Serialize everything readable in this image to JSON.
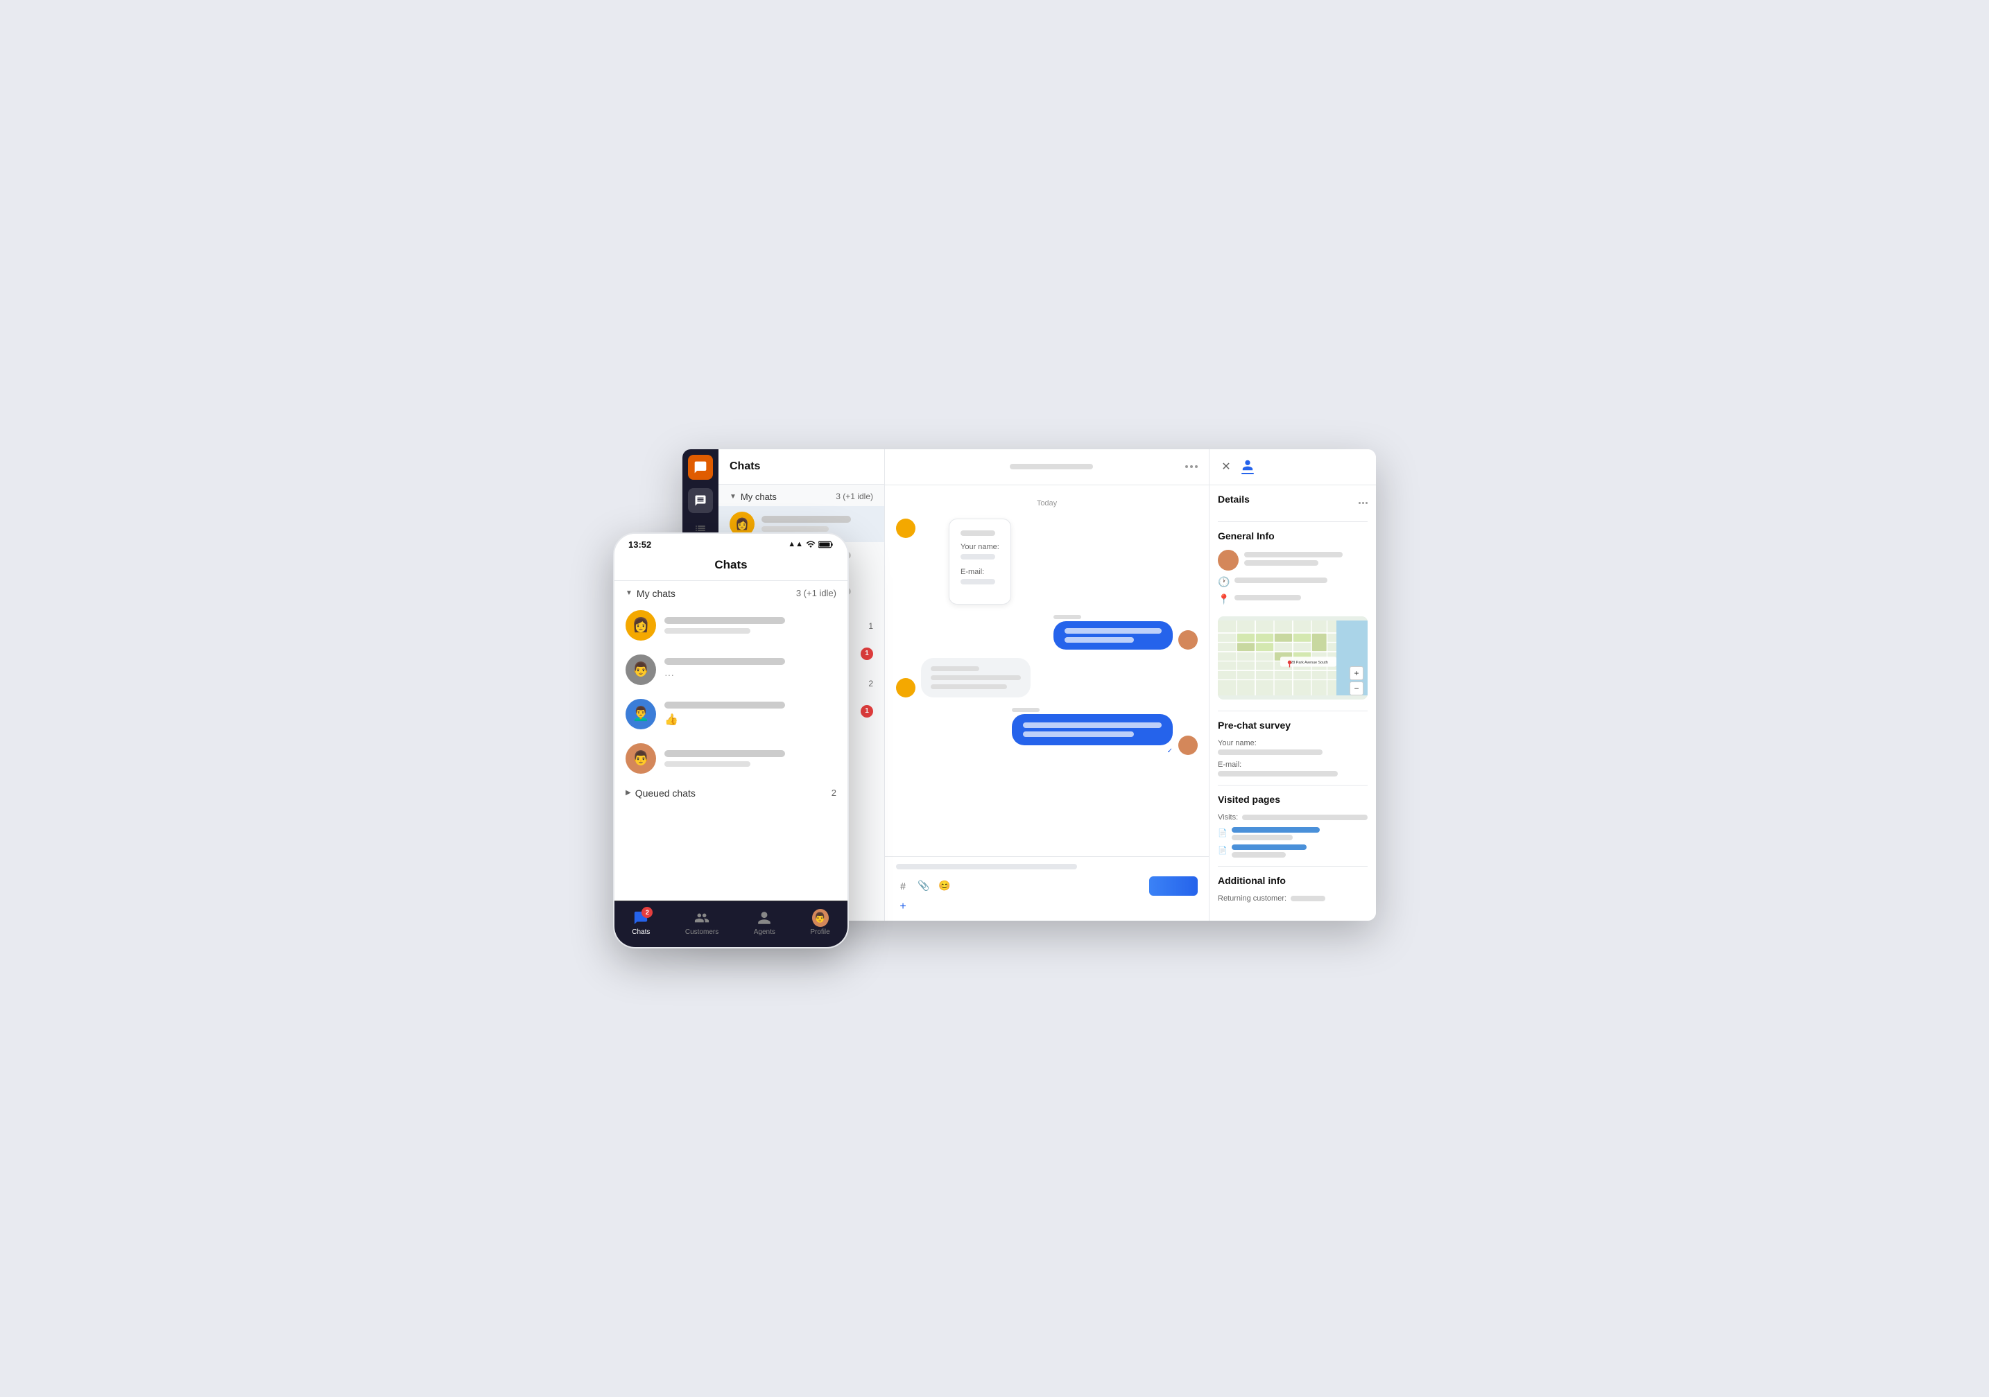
{
  "desktop": {
    "title": "Chats",
    "sidebar": {
      "icons": [
        "chat-bubble",
        "list",
        "inbox",
        "ticket"
      ]
    },
    "chatList": {
      "myChats": {
        "label": "My chats",
        "count": "3 (+1 idle)"
      },
      "items": [
        {
          "id": 1,
          "avatarColor": "yellow",
          "selected": true
        },
        {
          "id": 2,
          "avatarColor": "gray",
          "hasDots": true
        }
      ]
    },
    "mainHeader": {
      "moreLabel": "···"
    },
    "messages": {
      "dateDivider": "Today",
      "prechat": {
        "yourNameLabel": "Your name:",
        "emailLabel": "E-mail:"
      }
    },
    "inputArea": {
      "hashLabel": "#",
      "attachLabel": "📎",
      "emojiLabel": "😊",
      "addLabel": "+"
    },
    "details": {
      "title": "Details",
      "moreLabel": "···",
      "sections": {
        "generalInfo": {
          "title": "General Info"
        },
        "prechatSurvey": {
          "title": "Pre-chat survey",
          "yourNameLabel": "Your name:",
          "emailLabel": "E-mail:"
        },
        "visitedPages": {
          "title": "Visited pages",
          "visitsLabel": "Visits:"
        },
        "additionalInfo": {
          "title": "Additional info",
          "returningLabel": "Returning customer:"
        }
      },
      "mapAddress": "228 Park Avenue South",
      "mapZoomIn": "+",
      "mapZoomOut": "−"
    }
  },
  "mobile": {
    "statusBar": {
      "time": "13:52",
      "signal": "▲▲",
      "wifi": "wifi",
      "battery": "🔋"
    },
    "header": {
      "title": "Chats"
    },
    "myChats": {
      "label": "My chats",
      "count": "3 (+1 idle)"
    },
    "chatItems": [
      {
        "id": 1,
        "avatarColor": "yellow",
        "emoji": "👩"
      },
      {
        "id": 2,
        "avatarColor": "gray",
        "hasDots": true,
        "emoji": "👨"
      },
      {
        "id": 3,
        "avatarColor": "blue",
        "hasThumb": true,
        "emoji": "👨‍🦱"
      },
      {
        "id": 4,
        "avatarColor": "peach",
        "emoji": "👨"
      }
    ],
    "queuedChats": {
      "label": "Queued chats",
      "count": "2"
    },
    "bottomNav": {
      "items": [
        {
          "id": "chats",
          "label": "Chats",
          "active": true,
          "badge": "2"
        },
        {
          "id": "customers",
          "label": "Customers",
          "active": false
        },
        {
          "id": "agents",
          "label": "Agents",
          "active": false
        },
        {
          "id": "profile",
          "label": "Profile",
          "active": false,
          "hasAvatar": true
        }
      ]
    }
  }
}
